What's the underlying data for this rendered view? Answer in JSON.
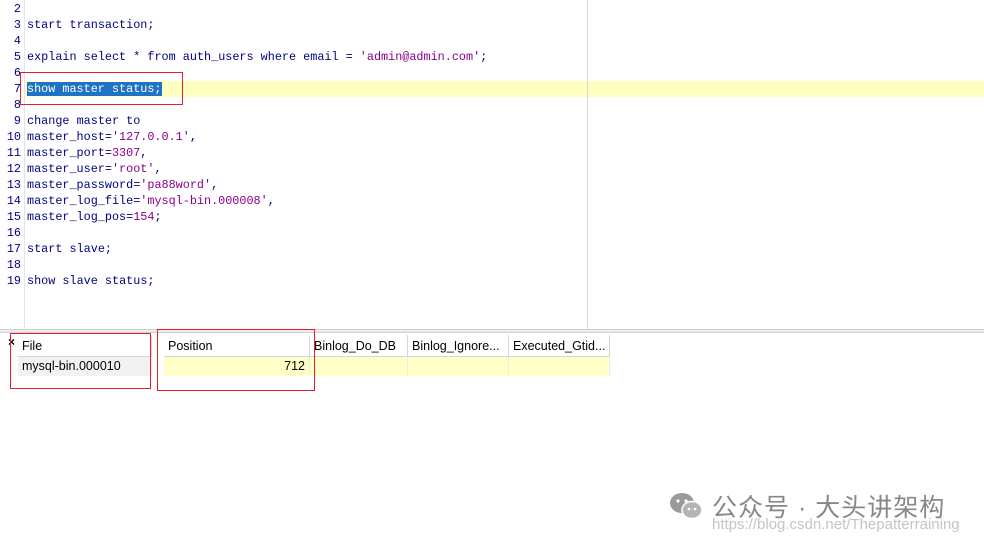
{
  "editor": {
    "lines": [
      {
        "num": "2",
        "text": ""
      },
      {
        "num": "3",
        "text": "start transaction;"
      },
      {
        "num": "4",
        "text": ""
      },
      {
        "num": "5",
        "text": "explain select * from auth_users where email = 'admin@admin.com';"
      },
      {
        "num": "6",
        "text": ""
      },
      {
        "num": "7",
        "text": "show master status;"
      },
      {
        "num": "8",
        "text": ""
      },
      {
        "num": "9",
        "text": "change master to"
      },
      {
        "num": "10",
        "text": "master_host='127.0.0.1',"
      },
      {
        "num": "11",
        "text": "master_port=3307,"
      },
      {
        "num": "12",
        "text": "master_user='root',"
      },
      {
        "num": "13",
        "text": "master_password='pa88word',"
      },
      {
        "num": "14",
        "text": "master_log_file='mysql-bin.000008',"
      },
      {
        "num": "15",
        "text": "master_log_pos=154;"
      },
      {
        "num": "16",
        "text": ""
      },
      {
        "num": "17",
        "text": "start slave;"
      },
      {
        "num": "18",
        "text": ""
      },
      {
        "num": "19",
        "text": "show slave status;"
      }
    ],
    "selected_line": "7"
  },
  "results": {
    "close_symbol": "×",
    "columns": [
      "File",
      "Position",
      "Binlog_Do_DB",
      "Binlog_Ignore...",
      "Executed_Gtid..."
    ],
    "rows": [
      [
        "mysql-bin.000010",
        "712",
        "",
        "",
        ""
      ]
    ]
  },
  "watermark": {
    "text": "公众号 · 大头讲架构",
    "url": "https://blog.csdn.net/Thepatterraining"
  },
  "colors": {
    "highlight_line": "#ffffc0",
    "selection": "#1e73c6",
    "annotation_red": "#e0202a",
    "code_text": "#00007f"
  }
}
